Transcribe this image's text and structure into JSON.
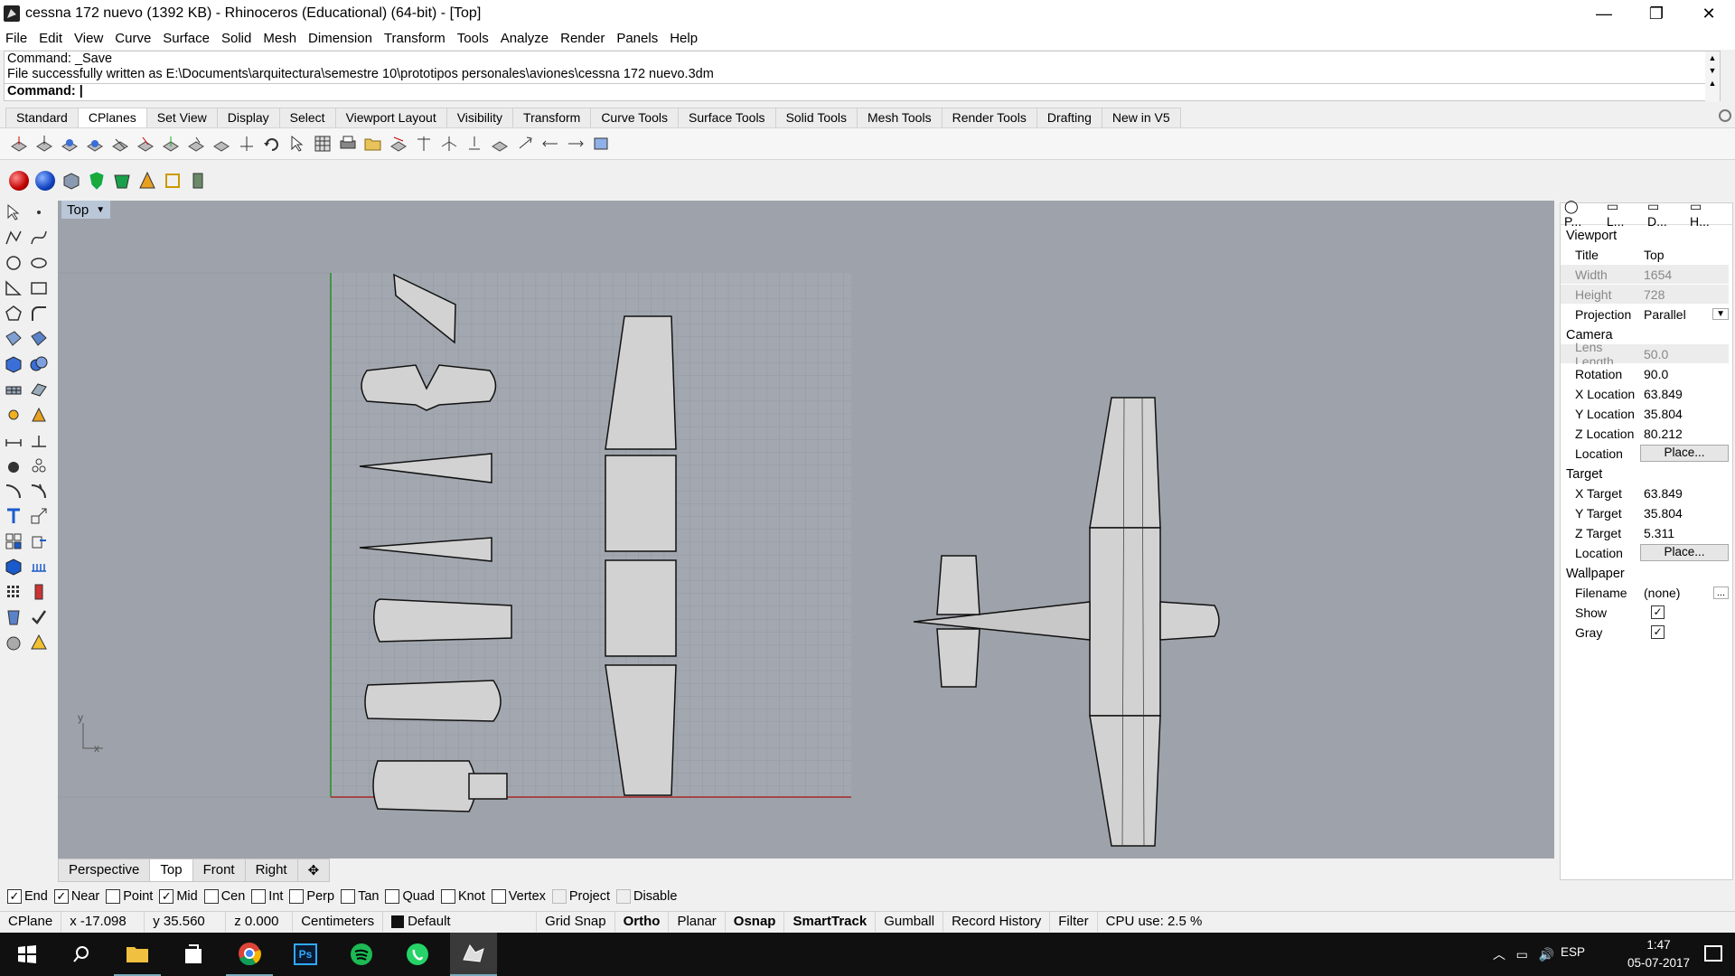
{
  "window": {
    "title": "cessna 172 nuevo (1392 KB) - Rhinoceros (Educational) (64-bit) - [Top]",
    "minimize": "—",
    "restore": "❐",
    "close": "✕"
  },
  "menu": [
    "File",
    "Edit",
    "View",
    "Curve",
    "Surface",
    "Solid",
    "Mesh",
    "Dimension",
    "Transform",
    "Tools",
    "Analyze",
    "Render",
    "Panels",
    "Help"
  ],
  "command": {
    "history_1": "Command: _Save",
    "history_2": "File successfully written as E:\\Documents\\arquitectura\\semestre 10\\prototipos personales\\aviones\\cessna 172 nuevo.3dm",
    "prompt": "Command:"
  },
  "toolbar_tabs": [
    "Standard",
    "CPlanes",
    "Set View",
    "Display",
    "Select",
    "Viewport Layout",
    "Visibility",
    "Transform",
    "Curve Tools",
    "Surface Tools",
    "Solid Tools",
    "Mesh Tools",
    "Render Tools",
    "Drafting",
    "New in V5"
  ],
  "viewport": {
    "label": "Top",
    "axis_x": "x",
    "axis_y": "y"
  },
  "view_tabs": [
    "Perspective",
    "Top",
    "Front",
    "Right"
  ],
  "osnap": [
    {
      "label": "End",
      "checked": true
    },
    {
      "label": "Near",
      "checked": true
    },
    {
      "label": "Point",
      "checked": false
    },
    {
      "label": "Mid",
      "checked": true
    },
    {
      "label": "Cen",
      "checked": false
    },
    {
      "label": "Int",
      "checked": false
    },
    {
      "label": "Perp",
      "checked": false
    },
    {
      "label": "Tan",
      "checked": false
    },
    {
      "label": "Quad",
      "checked": false
    },
    {
      "label": "Knot",
      "checked": false
    },
    {
      "label": "Vertex",
      "checked": false
    },
    {
      "label": "Project",
      "checked": false
    },
    {
      "label": "Disable",
      "checked": false
    }
  ],
  "status": {
    "cplane": "CPlane",
    "x": "x -17.098",
    "y": "y 35.560",
    "z": "z 0.000",
    "units": "Centimeters",
    "layer": "Default",
    "grid_snap": "Grid Snap",
    "ortho": "Ortho",
    "planar": "Planar",
    "osnap": "Osnap",
    "smarttrack": "SmartTrack",
    "gumball": "Gumball",
    "record_history": "Record History",
    "filter": "Filter",
    "cpu": "CPU use: 2.5 %"
  },
  "panel": {
    "tabs": [
      "P...",
      "L...",
      "D...",
      "H..."
    ],
    "viewport_section": "Viewport",
    "title_k": "Title",
    "title_v": "Top",
    "width_k": "Width",
    "width_v": "1654",
    "height_k": "Height",
    "height_v": "728",
    "projection_k": "Projection",
    "projection_v": "Parallel",
    "camera_section": "Camera",
    "lens_k": "Lens Length",
    "lens_v": "50.0",
    "rotation_k": "Rotation",
    "rotation_v": "90.0",
    "xloc_k": "X Location",
    "xloc_v": "63.849",
    "yloc_k": "Y Location",
    "yloc_v": "35.804",
    "zloc_k": "Z Location",
    "zloc_v": "80.212",
    "loc_k": "Location",
    "place_btn": "Place...",
    "target_section": "Target",
    "xt_k": "X Target",
    "xt_v": "63.849",
    "yt_k": "Y Target",
    "yt_v": "35.804",
    "zt_k": "Z Target",
    "zt_v": "5.311",
    "tloc_k": "Location",
    "wallpaper_section": "Wallpaper",
    "filename_k": "Filename",
    "filename_v": "(none)",
    "show_k": "Show",
    "gray_k": "Gray"
  },
  "taskbar": {
    "lang": "ESP",
    "time": "1:47",
    "date": "05-07-2017"
  },
  "icons": [
    "windows-start-icon",
    "search-icon",
    "file-explorer-icon",
    "store-icon",
    "chrome-icon",
    "photoshop-icon",
    "spotify-icon",
    "whatsapp-icon",
    "rhino-icon"
  ]
}
